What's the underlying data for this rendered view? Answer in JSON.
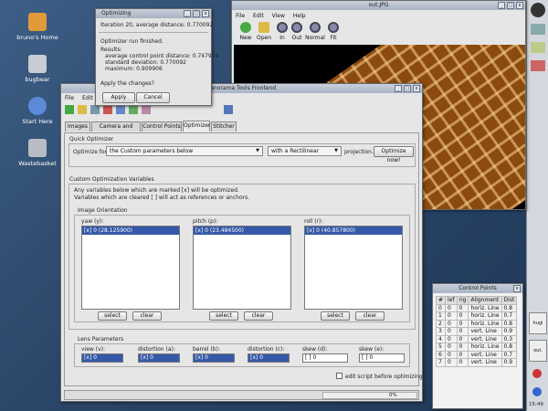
{
  "desktop": {
    "icons": [
      {
        "label": "bruno's Home",
        "icon": "home-folder-icon",
        "color": "#e09a3a"
      },
      {
        "label": "bugbear",
        "icon": "computer-icon",
        "color": "#c8ccd4"
      },
      {
        "label": "Start Here",
        "icon": "start-here-icon",
        "color": "#5a8ad8"
      },
      {
        "label": "Wastebasket",
        "icon": "trash-icon",
        "color": "#b8bcc4"
      }
    ]
  },
  "panel": {
    "clock": "15:49",
    "tasks": [
      {
        "label": "hugi"
      },
      {
        "label": "out."
      }
    ]
  },
  "image_viewer": {
    "title": "out.JPG",
    "menu": [
      "File",
      "Edit",
      "View",
      "Help"
    ],
    "tools": [
      {
        "label": "New",
        "icon": "new-icon"
      },
      {
        "label": "Open",
        "icon": "open-folder-icon"
      },
      {
        "label": "In",
        "icon": "zoom-in-icon"
      },
      {
        "label": "Out",
        "icon": "zoom-out-icon"
      },
      {
        "label": "Normal",
        "icon": "zoom-normal-icon"
      },
      {
        "label": "Fit",
        "icon": "zoom-fit-icon"
      }
    ]
  },
  "main_window": {
    "title": "Panorama Tools Frontend",
    "menu": [
      "File",
      "Edit"
    ],
    "tabs": [
      "Images",
      "Camera and Lens",
      "Control Points",
      "Optimizer",
      "Stitcher"
    ],
    "active_tab": "Optimizer",
    "quick_optimizer": {
      "title": "Quick Optimizer",
      "optimize_for_label": "Optimize for",
      "optimize_for_value": "the Custom parameters below",
      "projection_value": "with a Rectilinear",
      "projection_label": "projection.",
      "optimize_button": "Optimize now!"
    },
    "custom_vars": {
      "title": "Custom Optimization Variables",
      "line1": "Any variables below which are marked [x] will be optimized.",
      "line2": "Variables which are cleared [ ] will act as references or anchors.",
      "orientation_title": "Image Orientation",
      "columns": [
        {
          "label": "yaw (y):",
          "item": "[x] 0 (28.125900)"
        },
        {
          "label": "pitch (p):",
          "item": "[x] 0 (23.484500)"
        },
        {
          "label": "roll (r):",
          "item": "[x] 0 (40.857800)"
        }
      ],
      "select_label": "select",
      "clear_label": "clear"
    },
    "lens": {
      "title": "Lens Parameters",
      "params": [
        {
          "label": "view (v):",
          "value": "[x] 0",
          "selected": true
        },
        {
          "label": "distortion (a):",
          "value": "[x] 0",
          "selected": true
        },
        {
          "label": "barrel (b):",
          "value": "[x] 0",
          "selected": true
        },
        {
          "label": "distortion (c):",
          "value": "[x] 0",
          "selected": true
        },
        {
          "label": "skew (d):",
          "value": "[ ] 0",
          "selected": false
        },
        {
          "label": "skew (e):",
          "value": "[ ] 0",
          "selected": false
        }
      ]
    },
    "edit_script_label": "edit script before optimizing",
    "status_progress": "0%"
  },
  "optimizing_dialog": {
    "title": "Optimizing",
    "iteration": "Iteration 20, average distance: 0.770092",
    "finished": "Optimizer run finished.",
    "results_label": "Results:",
    "results": [
      "average control point distance: 0.747974",
      "standard deviation: 0.770092",
      "maximum: 0.909906"
    ],
    "question": "Apply the changes?",
    "apply_label": "Apply",
    "cancel_label": "Cancel"
  },
  "control_points": {
    "title": "Control Points",
    "headers": [
      "#",
      "lef",
      "rig",
      "Alignment",
      "Dist"
    ],
    "rows": [
      [
        "0",
        "0",
        "0",
        "horiz. Line",
        "0.8"
      ],
      [
        "1",
        "0",
        "0",
        "horiz. Line",
        "0.7"
      ],
      [
        "2",
        "0",
        "0",
        "horiz. Line",
        "0.8"
      ],
      [
        "3",
        "0",
        "0",
        "vert. Line",
        "0.9"
      ],
      [
        "4",
        "0",
        "0",
        "vert. Line",
        "0.3"
      ],
      [
        "5",
        "0",
        "0",
        "horiz. Line",
        "0.8"
      ],
      [
        "6",
        "0",
        "0",
        "vert. Line",
        "0.7"
      ],
      [
        "7",
        "0",
        "0",
        "vert. Line",
        "0.9"
      ]
    ]
  },
  "colors": {
    "selection": "#3559a8",
    "desktop": "#2e4a6d",
    "panorama_tile": "#8a4a10"
  }
}
